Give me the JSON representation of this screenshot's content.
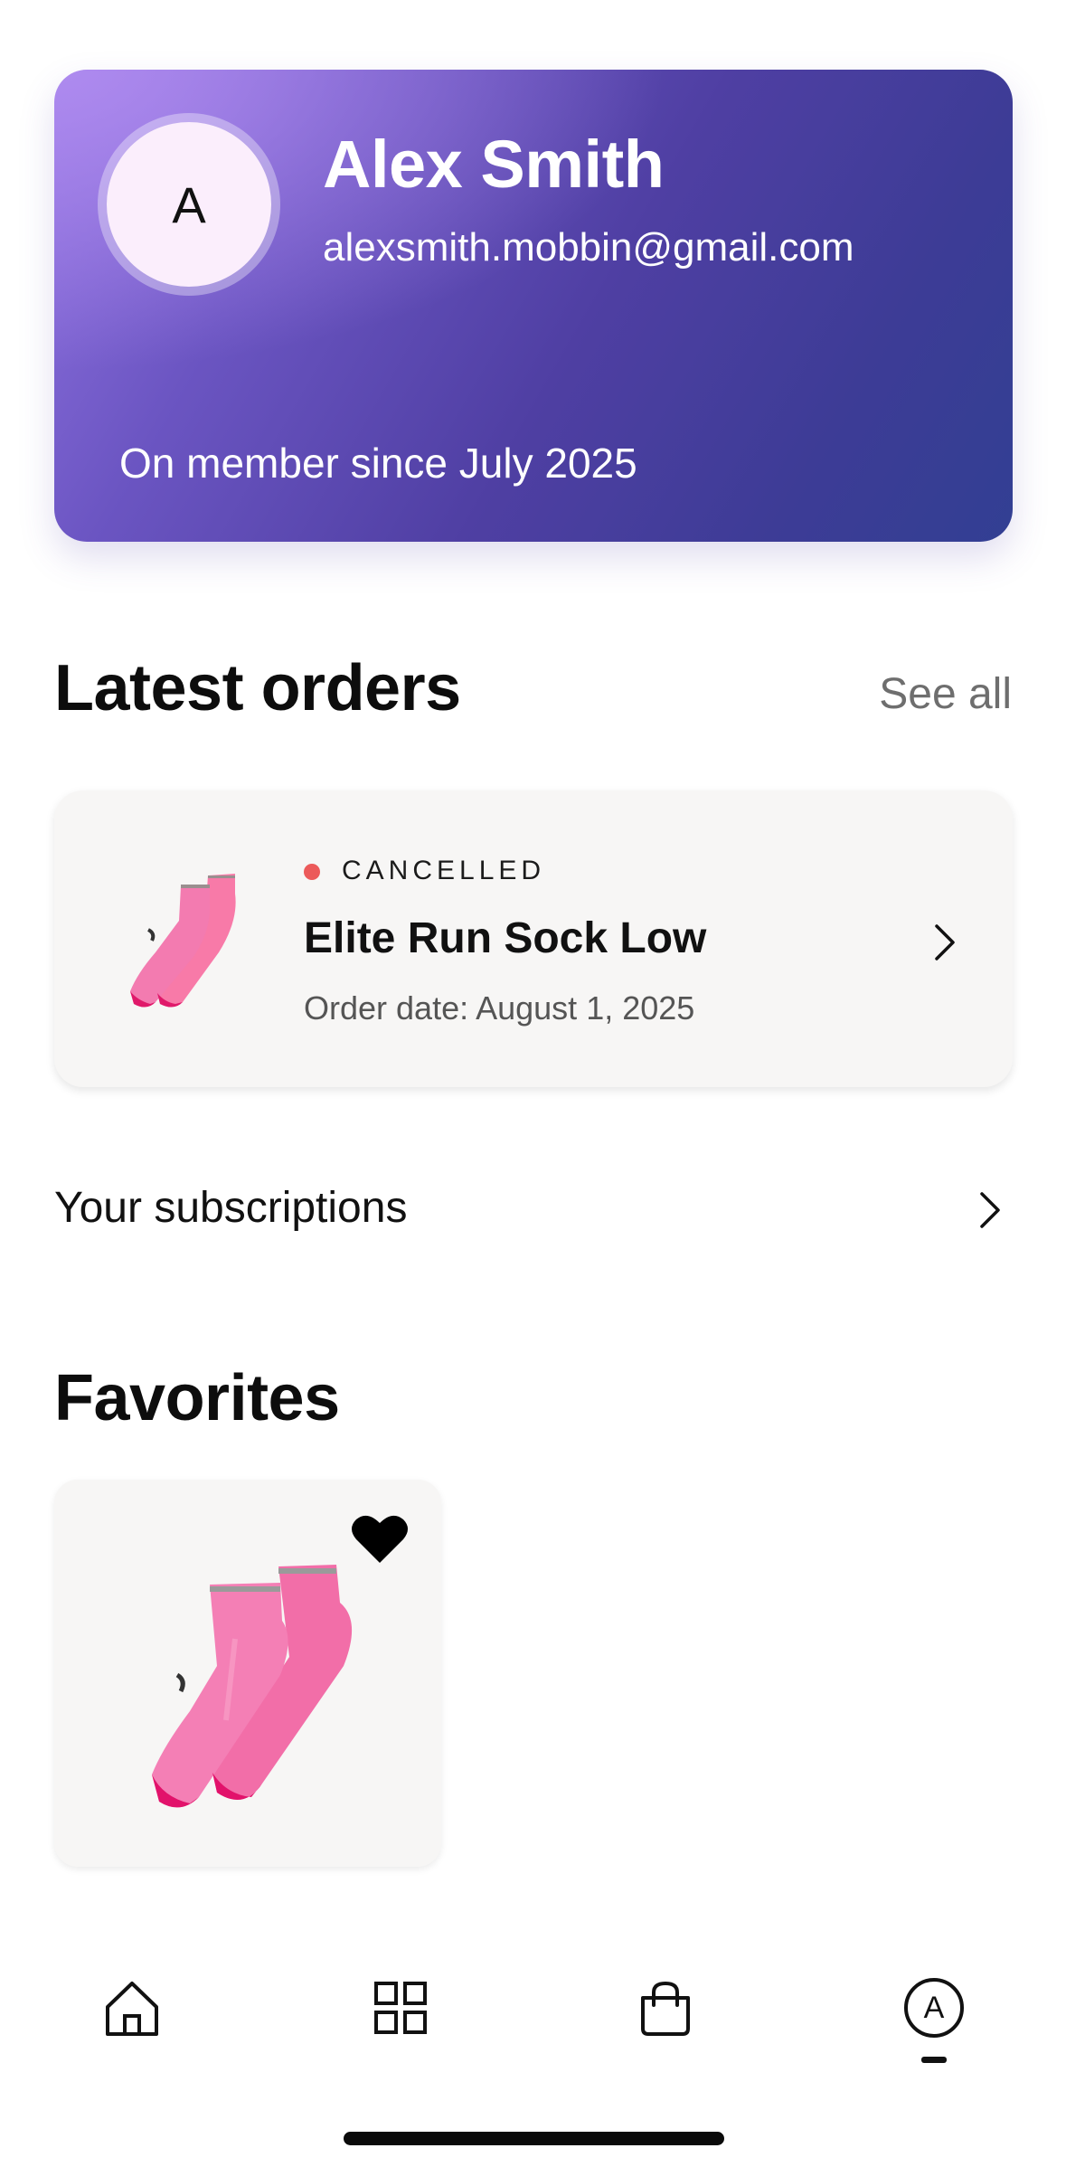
{
  "profile": {
    "initial": "A",
    "name": "Alex Smith",
    "email": "alexsmith.mobbin@gmail.com",
    "member_since": "On member since July 2025",
    "gradient_colors": [
      "#9a7ae6",
      "#4f3fa3",
      "#323f93"
    ]
  },
  "latest_orders": {
    "title": "Latest orders",
    "see_all_label": "See all",
    "orders": [
      {
        "status": "CANCELLED",
        "status_color": "#ec5a5a",
        "product_name": "Elite Run Sock Low",
        "order_date": "Order date: August 1, 2025",
        "thumbnail": "pink-sock-image",
        "chevron": "chevron-right-icon"
      }
    ]
  },
  "subscriptions": {
    "label": "Your subscriptions",
    "chevron": "chevron-right-icon"
  },
  "favorites": {
    "title": "Favorites",
    "items": [
      {
        "image": "pink-sock-image",
        "favorited": true,
        "heart_icon": "heart-filled-icon"
      }
    ]
  },
  "bottom_nav": {
    "items": [
      {
        "icon": "home-icon",
        "active": false
      },
      {
        "icon": "grid-icon",
        "active": false
      },
      {
        "icon": "shopping-bag-icon",
        "active": false
      },
      {
        "icon": "profile-avatar-icon",
        "label": "A",
        "active": true
      }
    ]
  }
}
